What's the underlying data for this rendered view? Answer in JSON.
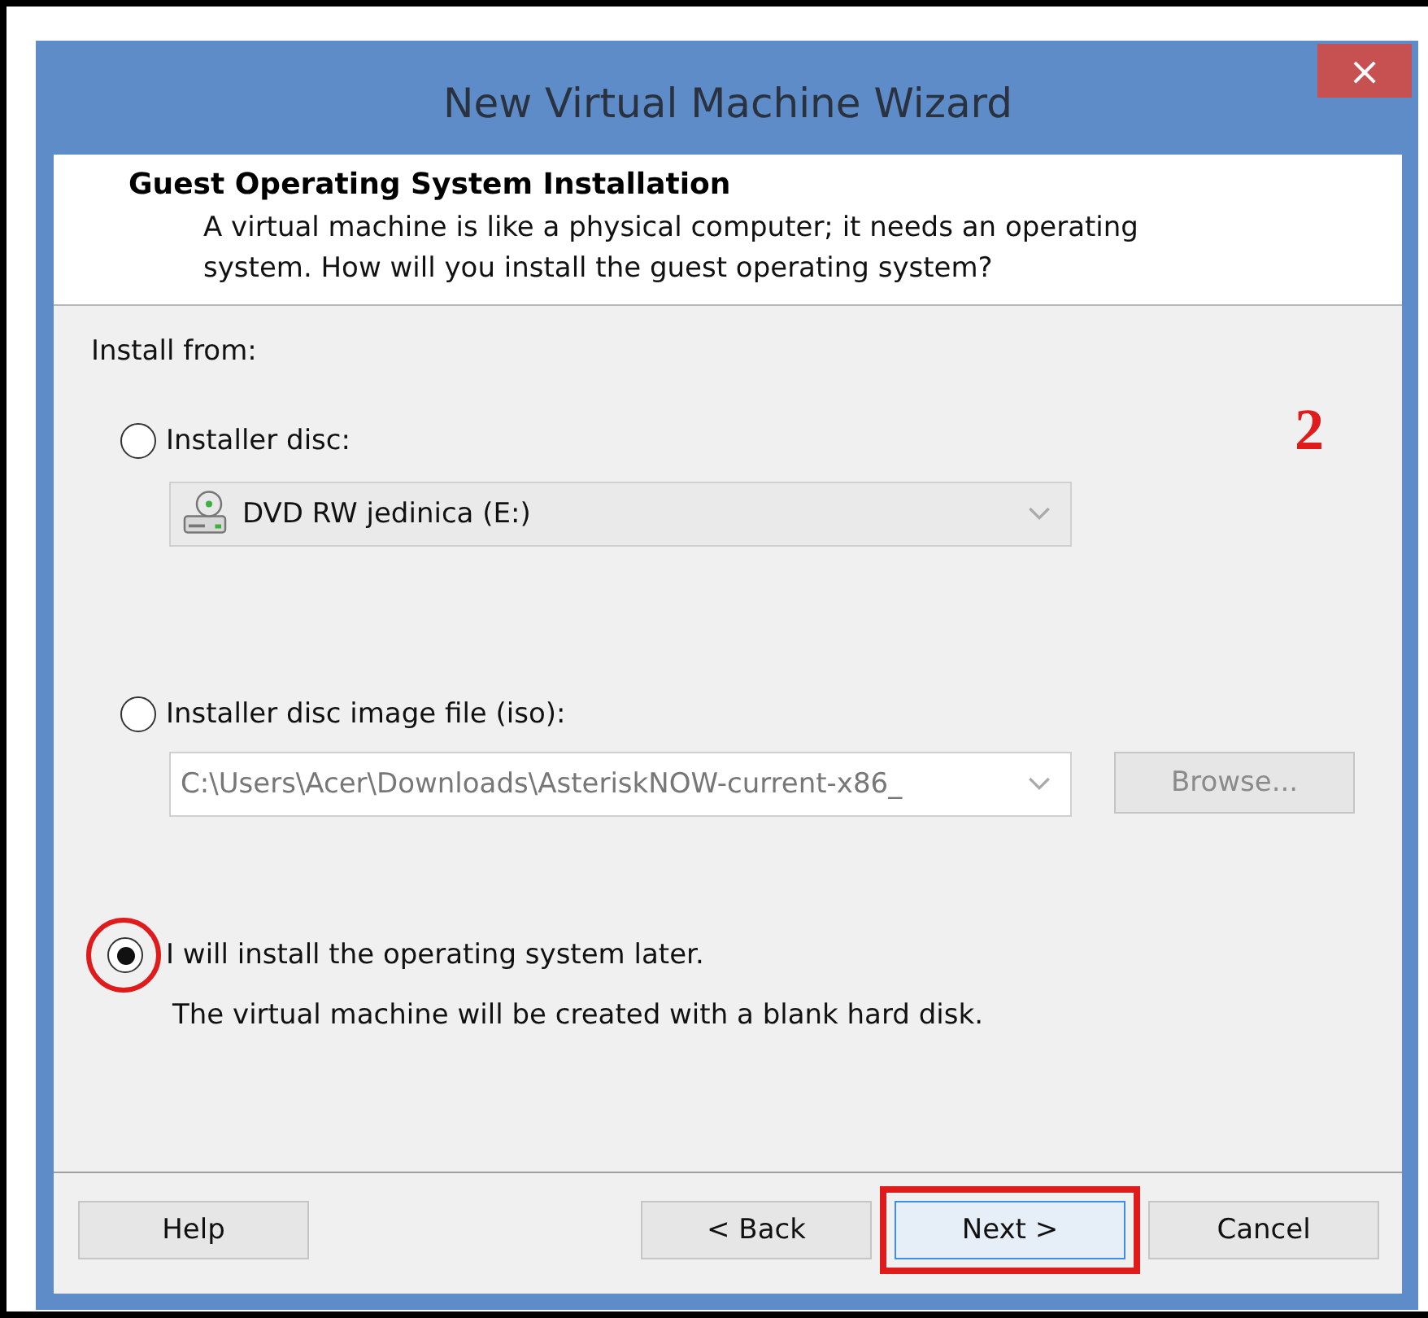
{
  "window": {
    "title": "New Virtual Machine Wizard",
    "close": "×"
  },
  "header": {
    "title": "Guest Operating System Installation",
    "description": "A virtual machine is like a physical computer; it needs an operating system. How will you install the guest operating system?"
  },
  "install_from": "Install from:",
  "annotation_number": "2",
  "options": [
    {
      "kind": "disc",
      "label": "Installer disc:",
      "selected": false,
      "circled": false,
      "dropdown": {
        "value": "DVD RW jedinica (E:)",
        "disabled": false
      }
    },
    {
      "kind": "iso",
      "label": "Installer disc image file (iso):",
      "selected": false,
      "circled": false,
      "dropdown": {
        "value": "C:\\Users\\Acer\\Downloads\\AsteriskNOW-current-x86_",
        "disabled": true
      },
      "browse": {
        "label": "Browse...",
        "disabled": true
      }
    },
    {
      "kind": "later",
      "label": "I will install the operating system later.",
      "selected": true,
      "circled": true,
      "note": "The virtual machine will be created with a blank hard disk."
    }
  ],
  "buttons": [
    {
      "label": "Help",
      "focused": false,
      "boxed": false
    },
    {
      "label": "< Back",
      "focused": false,
      "boxed": false
    },
    {
      "label": "Next >",
      "focused": true,
      "boxed": true
    },
    {
      "label": "Cancel",
      "focused": false,
      "boxed": false
    }
  ]
}
